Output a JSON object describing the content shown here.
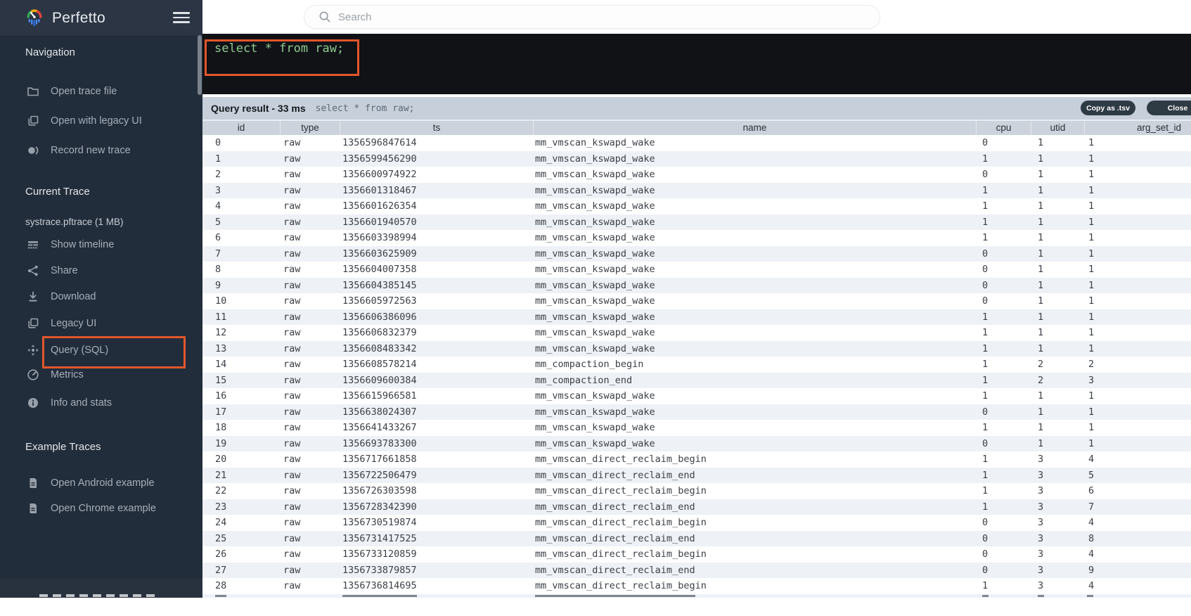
{
  "sidebar": {
    "brand_title": "Perfetto",
    "nav_heading": "Navigation",
    "nav_items": [
      "Open trace file",
      "Open with legacy UI",
      "Record new trace"
    ],
    "current_heading": "Current Trace",
    "trace_name": "systrace.pftrace (1 MB)",
    "trace_items": [
      "Show timeline",
      "Share",
      "Download",
      "Legacy UI",
      "Query (SQL)",
      "Metrics",
      "Info and stats"
    ],
    "examples_heading": "Example Traces",
    "example_items": [
      "Open Android example",
      "Open Chrome example"
    ]
  },
  "topbar": {
    "search_placeholder": "Search"
  },
  "editor": {
    "content": "select * from raw;"
  },
  "result": {
    "title": "Query result - 33 ms",
    "query_echo": "select * from raw;",
    "copy_button": "Copy as .tsv",
    "close_button": "Close"
  },
  "table": {
    "columns": [
      "id",
      "type",
      "ts",
      "name",
      "cpu",
      "utid",
      "arg_set_id"
    ],
    "rows": [
      [
        "0",
        "raw",
        "1356596847614",
        "mm_vmscan_kswapd_wake",
        "0",
        "1",
        "1"
      ],
      [
        "1",
        "raw",
        "1356599456290",
        "mm_vmscan_kswapd_wake",
        "1",
        "1",
        "1"
      ],
      [
        "2",
        "raw",
        "1356600974922",
        "mm_vmscan_kswapd_wake",
        "0",
        "1",
        "1"
      ],
      [
        "3",
        "raw",
        "1356601318467",
        "mm_vmscan_kswapd_wake",
        "1",
        "1",
        "1"
      ],
      [
        "4",
        "raw",
        "1356601626354",
        "mm_vmscan_kswapd_wake",
        "1",
        "1",
        "1"
      ],
      [
        "5",
        "raw",
        "1356601940570",
        "mm_vmscan_kswapd_wake",
        "1",
        "1",
        "1"
      ],
      [
        "6",
        "raw",
        "1356603398994",
        "mm_vmscan_kswapd_wake",
        "1",
        "1",
        "1"
      ],
      [
        "7",
        "raw",
        "1356603625909",
        "mm_vmscan_kswapd_wake",
        "0",
        "1",
        "1"
      ],
      [
        "8",
        "raw",
        "1356604007358",
        "mm_vmscan_kswapd_wake",
        "0",
        "1",
        "1"
      ],
      [
        "9",
        "raw",
        "1356604385145",
        "mm_vmscan_kswapd_wake",
        "0",
        "1",
        "1"
      ],
      [
        "10",
        "raw",
        "1356605972563",
        "mm_vmscan_kswapd_wake",
        "0",
        "1",
        "1"
      ],
      [
        "11",
        "raw",
        "1356606386096",
        "mm_vmscan_kswapd_wake",
        "1",
        "1",
        "1"
      ],
      [
        "12",
        "raw",
        "1356606832379",
        "mm_vmscan_kswapd_wake",
        "1",
        "1",
        "1"
      ],
      [
        "13",
        "raw",
        "1356608483342",
        "mm_vmscan_kswapd_wake",
        "1",
        "1",
        "1"
      ],
      [
        "14",
        "raw",
        "1356608578214",
        "mm_compaction_begin",
        "1",
        "2",
        "2"
      ],
      [
        "15",
        "raw",
        "1356609600384",
        "mm_compaction_end",
        "1",
        "2",
        "3"
      ],
      [
        "16",
        "raw",
        "1356615966581",
        "mm_vmscan_kswapd_wake",
        "1",
        "1",
        "1"
      ],
      [
        "17",
        "raw",
        "1356638024307",
        "mm_vmscan_kswapd_wake",
        "0",
        "1",
        "1"
      ],
      [
        "18",
        "raw",
        "1356641433267",
        "mm_vmscan_kswapd_wake",
        "1",
        "1",
        "1"
      ],
      [
        "19",
        "raw",
        "1356693783300",
        "mm_vmscan_kswapd_wake",
        "0",
        "1",
        "1"
      ],
      [
        "20",
        "raw",
        "1356717661858",
        "mm_vmscan_direct_reclaim_begin",
        "1",
        "3",
        "4"
      ],
      [
        "21",
        "raw",
        "1356722506479",
        "mm_vmscan_direct_reclaim_end",
        "1",
        "3",
        "5"
      ],
      [
        "22",
        "raw",
        "1356726303598",
        "mm_vmscan_direct_reclaim_begin",
        "1",
        "3",
        "6"
      ],
      [
        "23",
        "raw",
        "1356728342390",
        "mm_vmscan_direct_reclaim_end",
        "1",
        "3",
        "7"
      ],
      [
        "24",
        "raw",
        "1356730519874",
        "mm_vmscan_direct_reclaim_begin",
        "0",
        "3",
        "4"
      ],
      [
        "25",
        "raw",
        "1356731417525",
        "mm_vmscan_direct_reclaim_end",
        "0",
        "3",
        "8"
      ],
      [
        "26",
        "raw",
        "1356733120859",
        "mm_vmscan_direct_reclaim_begin",
        "0",
        "3",
        "4"
      ],
      [
        "27",
        "raw",
        "1356733879857",
        "mm_vmscan_direct_reclaim_end",
        "0",
        "3",
        "9"
      ],
      [
        "28",
        "raw",
        "1356736814695",
        "mm_vmscan_direct_reclaim_begin",
        "1",
        "3",
        "4"
      ]
    ]
  },
  "colors": {
    "annotation_highlight": "#e2562b",
    "sidebar_bg": "#222d3b",
    "sidebar_header_bg": "#2b3544",
    "editor_bg": "#101216",
    "editor_text_green": "#8fca8f",
    "result_bar_bg": "#c6cfda",
    "table_header_bg": "#ccd3dc",
    "row_alt_bg": "#eef1f6",
    "pill_button_bg": "#2e3a44",
    "logo_green": "#36a852",
    "logo_yellow": "#f9ab00",
    "logo_red": "#e8453c",
    "logo_blue": "#4b8bf5"
  }
}
